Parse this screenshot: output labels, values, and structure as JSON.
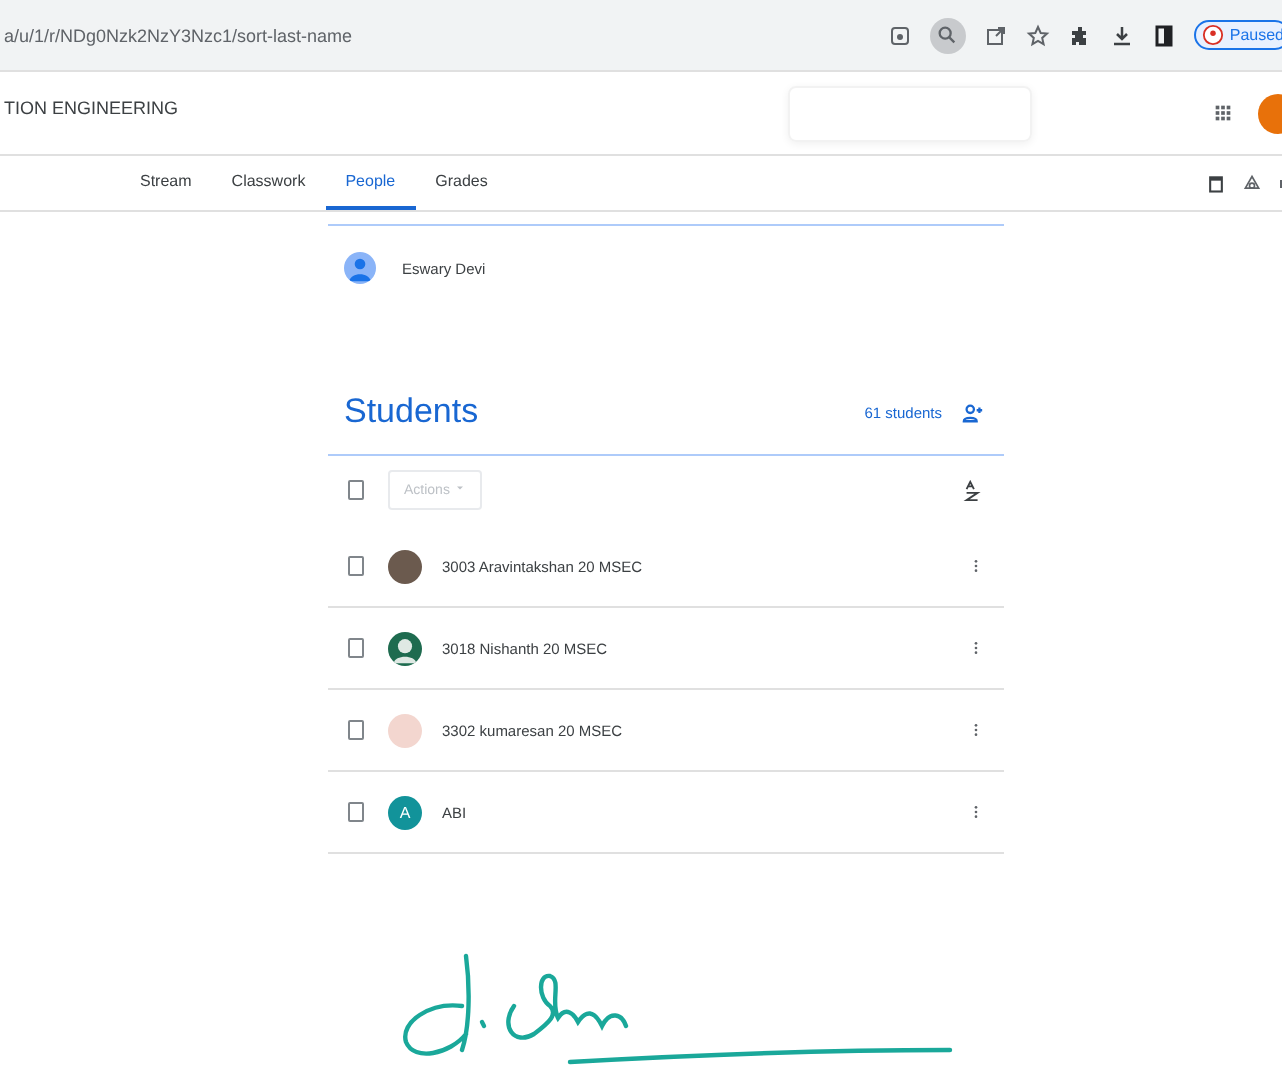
{
  "browser": {
    "url": "a/u/1/r/NDg0Nzk2NzY3Nzc1/sort-last-name",
    "profile_label": "Paused"
  },
  "class_header": {
    "title": "TION ENGINEERING"
  },
  "tabs": [
    {
      "label": "Stream",
      "selected": false
    },
    {
      "label": "Classwork",
      "selected": false
    },
    {
      "label": "People",
      "selected": true
    },
    {
      "label": "Grades",
      "selected": false
    }
  ],
  "teachers": [
    {
      "name": "Eswary Devi",
      "avatar": {
        "kind": "default"
      }
    }
  ],
  "students": {
    "heading": "Students",
    "count": "61 students",
    "actions_label": "Actions",
    "select_all_checked": false,
    "rows": [
      {
        "name": "3003 Aravintakshan 20 MSEC",
        "avatar": {
          "kind": "photo"
        },
        "color": "#6b5a4e",
        "checked": false
      },
      {
        "name": "3018 Nishanth 20 MSEC",
        "avatar": {
          "kind": "silhouette"
        },
        "color": "#1e6b4f",
        "checked": false
      },
      {
        "name": "3302 kumaresan 20 MSEC",
        "avatar": {
          "kind": "photo"
        },
        "color": "#f3d6cf",
        "checked": false
      },
      {
        "name": "ABI",
        "avatar": {
          "kind": "letter"
        },
        "letter": "A",
        "color": "#12939a",
        "checked": false
      }
    ]
  }
}
